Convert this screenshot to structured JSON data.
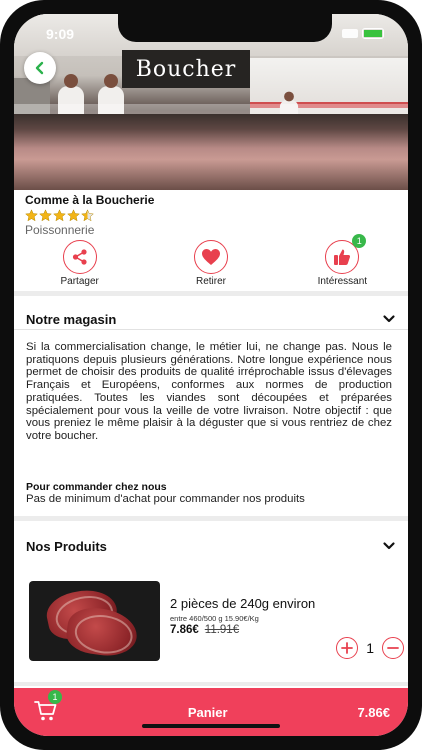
{
  "status": {
    "time": "9:09"
  },
  "hero": {
    "sign_text": "Boucher"
  },
  "store": {
    "name": "Comme à la Boucherie",
    "rating": 4.5,
    "rating_max": 5,
    "category": "Poissonnerie"
  },
  "actions": [
    {
      "label": "Partager",
      "icon": "share-icon"
    },
    {
      "label": "Retirer",
      "icon": "heart-icon"
    },
    {
      "label": "Intéressant",
      "icon": "thumbs-up-icon",
      "badge": "1"
    }
  ],
  "about_section": {
    "title": "Notre magasin",
    "text": "Si la commercialisation change, le métier lui, ne change pas. Nous le pratiquons depuis plusieurs générations. Notre longue expérience nous permet de choisir des produits de qualité irréprochable issus d'élevages Français et Européens, conformes aux normes de production pratiquées. Toutes les viandes sont découpées et préparées spécialement pour vous la veille de votre livraison. Notre objectif : que vous preniez le même plaisir à la déguster que si vous rentriez de chez votre boucher.",
    "order_title": "Pour commander chez nous",
    "order_text": "Pas de minimum d'achat pour commander nos produits"
  },
  "products_section": {
    "title": "Nos Produits",
    "items": [
      {
        "title": "2 pièces de 240g environ",
        "unit_info": "entre 460/500 g 15.90€/Kg",
        "price": "7.86€",
        "old_price": "11.91€",
        "quantity": "1"
      }
    ]
  },
  "cart": {
    "label": "Panier",
    "total": "7.86€",
    "badge": "1"
  },
  "colors": {
    "accent": "#e8404e",
    "cart_bar": "#f0405b",
    "badge": "#38b84a",
    "star": "#f2b416"
  }
}
